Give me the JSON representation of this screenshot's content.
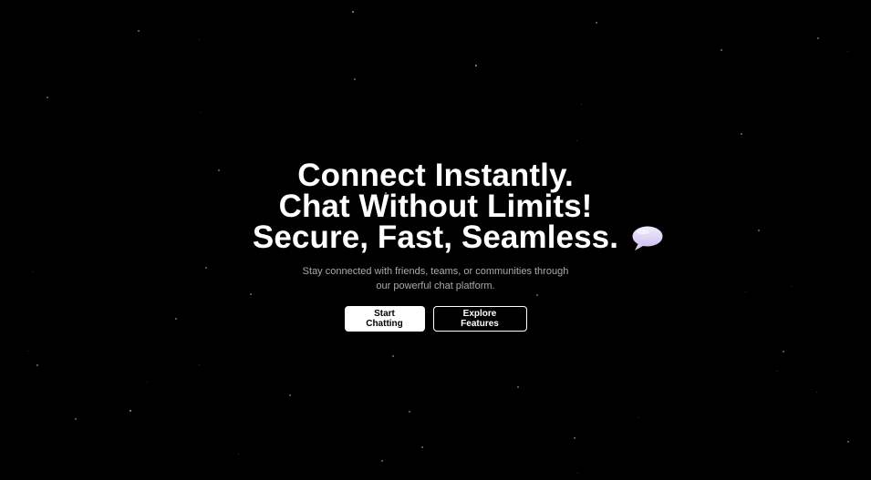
{
  "hero": {
    "headline": {
      "line1": "Connect Instantly.",
      "line2": "Chat Without Limits!",
      "line3": "Secure, Fast, Seamless."
    },
    "subtitle": "Stay connected with friends, teams, or communities through our powerful chat platform.",
    "emoji_icon": "speech-bubble-icon"
  },
  "actions": {
    "primary_label": "Start Chatting",
    "secondary_label": "Explore Features"
  },
  "theme": {
    "background": "#000000",
    "text": "#ffffff",
    "subtitle_text": "#a9a9b2",
    "bubble_color": "#e2d9f8"
  }
}
